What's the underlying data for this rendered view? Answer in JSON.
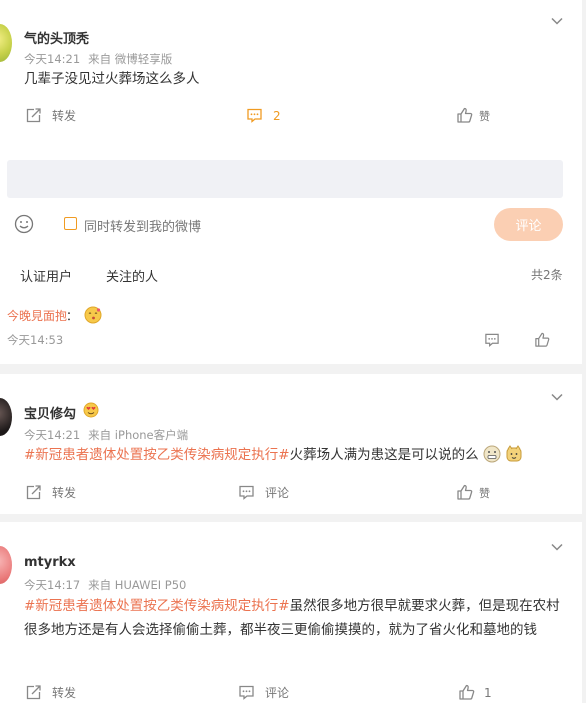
{
  "posts": [
    {
      "username": "气的头顶秃",
      "time": "今天14:21",
      "source": "来自 微博轻享版",
      "text": "几辈子没见过火葬场这么多人",
      "actions": {
        "repost": "转发",
        "comment": "2",
        "like": "赞"
      }
    },
    {
      "username": "宝贝修勾",
      "time": "今天14:21",
      "source": "来自 iPhone客户端",
      "topic": "#新冠患者遗体处置按乙类传染病规定执行#",
      "text": "火葬场人满为患这是可以说的么",
      "actions": {
        "repost": "转发",
        "comment": "评论",
        "like": "赞"
      }
    },
    {
      "username": "mtyrkx",
      "time": "今天14:17",
      "source": "来自 HUAWEI P50",
      "topic": "#新冠患者遗体处置按乙类传染病规定执行#",
      "text": "虽然很多地方很早就要求火葬，但是现在农村很多地方还是有人会选择偷偷土葬，都半夜三更偷偷摸摸的，就为了省火化和墓地的钱",
      "actions": {
        "repost": "转发",
        "comment": "评论",
        "like": "1"
      }
    }
  ],
  "composer": {
    "also_repost_label": "同时转发到我的微博",
    "submit_label": "评论"
  },
  "comment_filters": {
    "verified": "认证用户",
    "following": "关注的人",
    "total": "共2条"
  },
  "comments": [
    {
      "user": "今晚見面抱",
      "colon": "：",
      "time": "今天14:53"
    }
  ],
  "colors": {
    "accent": "#eb7350",
    "orange": "#f09b22",
    "muted": "#999999"
  }
}
